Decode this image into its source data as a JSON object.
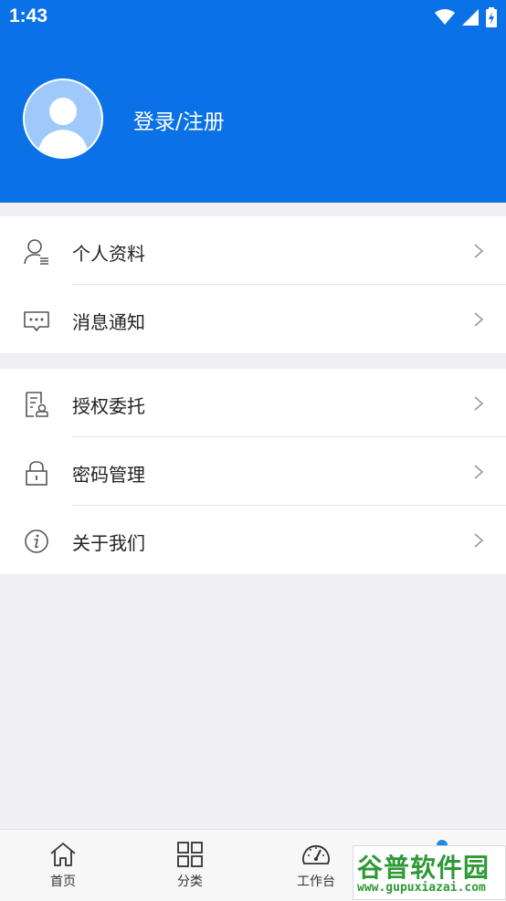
{
  "status_bar": {
    "time": "1:43"
  },
  "profile": {
    "login_label": "登录/注册"
  },
  "menu_group_1": [
    {
      "label": "个人资料",
      "icon": "user-profile-icon"
    },
    {
      "label": "消息通知",
      "icon": "message-icon"
    }
  ],
  "menu_group_2": [
    {
      "label": "授权委托",
      "icon": "authorization-document-icon"
    },
    {
      "label": "密码管理",
      "icon": "lock-icon"
    },
    {
      "label": "关于我们",
      "icon": "info-icon"
    }
  ],
  "tabbar": [
    {
      "label": "首页",
      "icon": "home-icon"
    },
    {
      "label": "分类",
      "icon": "grid-icon"
    },
    {
      "label": "工作台",
      "icon": "dashboard-icon"
    }
  ],
  "watermark": {
    "title": "谷普软件园",
    "url": "www.gupuxiazai.com"
  },
  "colors": {
    "header_blue": "#0a72e6",
    "background": "#efeff4",
    "watermark_green": "#2d9a35"
  }
}
